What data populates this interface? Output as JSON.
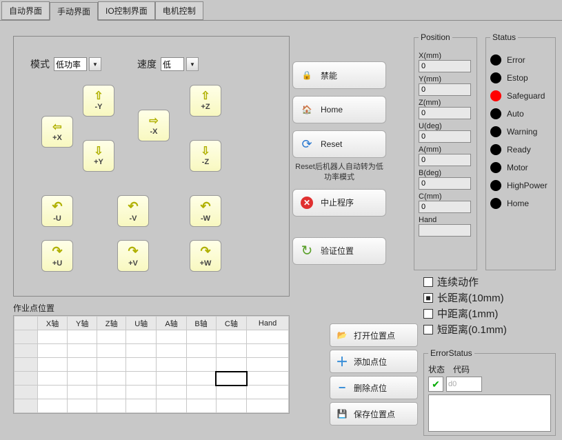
{
  "tabs": [
    "自动界面",
    "手动界面",
    "IO控制界面",
    "电机控制"
  ],
  "active_tab": 1,
  "mode": {
    "label": "模式",
    "value": "低功率"
  },
  "speed": {
    "label": "速度",
    "value": "低"
  },
  "jog": {
    "minus_y": "-Y",
    "plus_z": "+Z",
    "plus_x": "+X",
    "minus_x": "-X",
    "plus_y": "+Y",
    "minus_z": "-Z",
    "minus_u": "-U",
    "minus_v": "-V",
    "minus_w": "-W",
    "plus_u": "+U",
    "plus_v": "+V",
    "plus_w": "+W"
  },
  "cmds": {
    "disable": "禁能",
    "home": "Home",
    "reset": "Reset",
    "reset_note": "Reset后机器人自动转为低功率模式",
    "stop": "中止程序",
    "verify": "验证位置"
  },
  "position": {
    "title": "Position",
    "fields": [
      {
        "label": "X(mm)",
        "value": "0"
      },
      {
        "label": "Y(mm)",
        "value": "0"
      },
      {
        "label": "Z(mm)",
        "value": "0"
      },
      {
        "label": "U(deg)",
        "value": "0"
      },
      {
        "label": "A(mm)",
        "value": "0"
      },
      {
        "label": "B(deg)",
        "value": "0"
      },
      {
        "label": "C(mm)",
        "value": "0"
      }
    ],
    "hand_label": "Hand",
    "hand_value": ""
  },
  "status": {
    "title": "Status",
    "items": [
      {
        "label": "Error",
        "on": false
      },
      {
        "label": "Estop",
        "on": false
      },
      {
        "label": "Safeguard",
        "on": true
      },
      {
        "label": "Auto",
        "on": false
      },
      {
        "label": "Warning",
        "on": false
      },
      {
        "label": "Ready",
        "on": false
      },
      {
        "label": "Motor",
        "on": false
      },
      {
        "label": "HighPower",
        "on": false
      },
      {
        "label": "Home",
        "on": false
      }
    ]
  },
  "steps": {
    "continuous": "连续动作",
    "long": "长距离(10mm)",
    "medium": "中距离(1mm)",
    "short": "短距离(0.1mm)",
    "selected": 1
  },
  "worklist": {
    "title": "作业点位置",
    "headers": [
      "",
      "X轴",
      "Y轴",
      "Z轴",
      "U轴",
      "A轴",
      "B轴",
      "C轴",
      "Hand"
    ]
  },
  "point_btns": {
    "open": "打开位置点",
    "add": "添加点位",
    "del": "删除点位",
    "save": "保存位置点"
  },
  "err": {
    "title": "ErrorStatus",
    "state": "状态",
    "code": "代码",
    "state_val": "✔",
    "code_val": "d0"
  }
}
